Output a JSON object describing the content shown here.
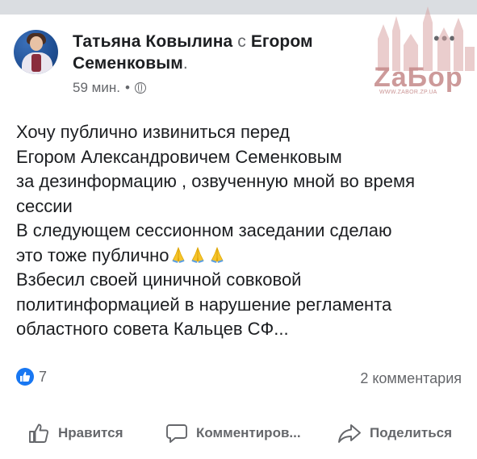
{
  "post": {
    "author": "Татьяна Ковылина",
    "with_word": "с",
    "tagged": "Егором Семенковым",
    "period": ".",
    "time": "59 мин.",
    "meta_sep": "•",
    "privacy_icon": "globe-icon",
    "more_icon": "more-options-icon",
    "lines": [
      "Хочу публично извиниться перед",
      "Егором Александровичем Семенковым",
      "за дезинформацию , озвученную мной во время",
      "сессии",
      "В следующем сессионном заседании сделаю",
      "это  тоже публично",
      "Взбесил своей циничной совковой",
      "политинформацией в нарушение регламента",
      "областного совета Кальцев  СФ..."
    ],
    "emoji": "🙏🙏🙏"
  },
  "watermark": {
    "text": "ZaБор",
    "url": "WWW.ZABOR.ZP.UA"
  },
  "stats": {
    "reaction_icon": "like-reaction-icon",
    "reactions": "7",
    "comments": "2 комментария"
  },
  "actions": {
    "like": "Нравится",
    "comment": "Комментиров...",
    "share": "Поделиться"
  },
  "colors": {
    "accent": "#1877f2",
    "secondary_text": "#65676b",
    "watermark": "#c58989"
  }
}
